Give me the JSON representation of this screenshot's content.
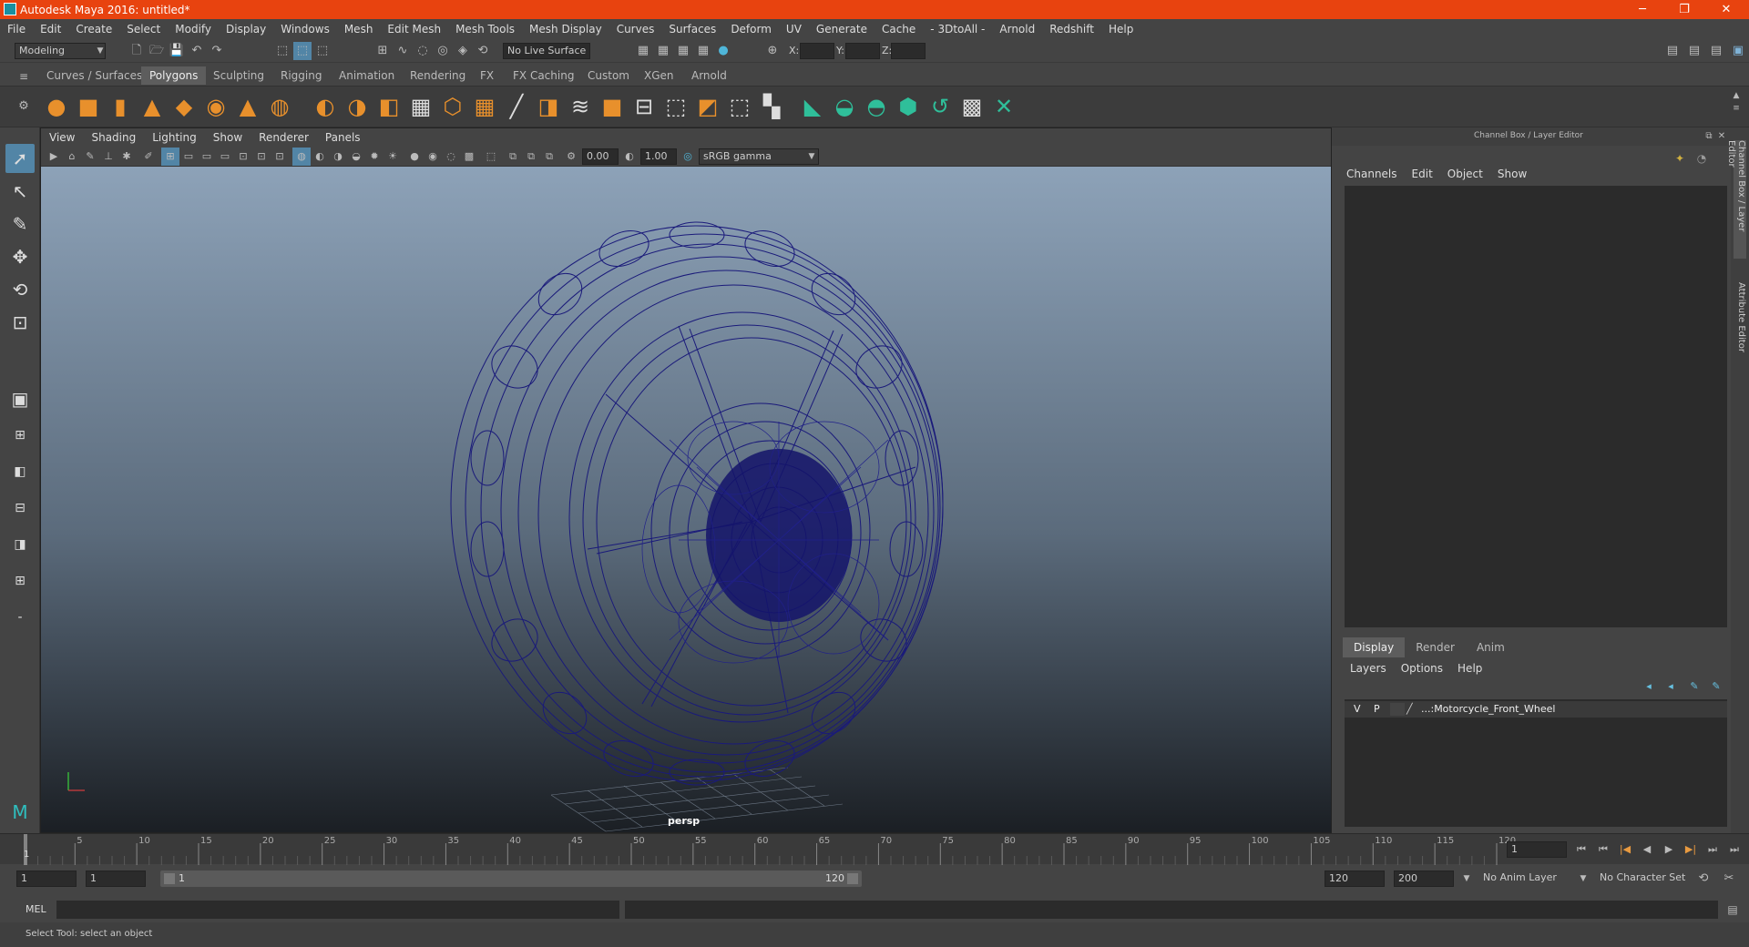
{
  "window": {
    "title": "Autodesk Maya 2016: untitled*",
    "min": "─",
    "restore": "❐",
    "close": "✕"
  },
  "menubar": [
    "File",
    "Edit",
    "Create",
    "Select",
    "Modify",
    "Display",
    "Windows",
    "Mesh",
    "Edit Mesh",
    "Mesh Tools",
    "Mesh Display",
    "Curves",
    "Surfaces",
    "Deform",
    "UV",
    "Generate",
    "Cache",
    "- 3DtoAll -",
    "Arnold",
    "Redshift",
    "Help"
  ],
  "statusline": {
    "mode": "Modeling",
    "live_surface": "No Live Surface",
    "x_label": "X:",
    "y_label": "Y:",
    "z_label": "Z:"
  },
  "shelf_tabs": [
    "Curves / Surfaces",
    "Polygons",
    "Sculpting",
    "Rigging",
    "Animation",
    "Rendering",
    "FX",
    "FX Caching",
    "Custom",
    "XGen",
    "Arnold"
  ],
  "shelf_active": "Polygons",
  "viewport": {
    "menu": [
      "View",
      "Shading",
      "Lighting",
      "Show",
      "Renderer",
      "Panels"
    ],
    "exposure": "0.00",
    "gamma": "1.00",
    "color_space": "sRGB gamma",
    "camera": "persp"
  },
  "channel_box": {
    "title": "Channel Box / Layer Editor",
    "menu": [
      "Channels",
      "Edit",
      "Object",
      "Show"
    ],
    "layer_tabs": [
      "Display",
      "Render",
      "Anim"
    ],
    "layer_menu": [
      "Layers",
      "Options",
      "Help"
    ],
    "layer": {
      "v": "V",
      "p": "P",
      "name": "...:Motorcycle_Front_Wheel"
    }
  },
  "right_tabs": [
    "Channel Box / Layer Editor",
    "Attribute Editor"
  ],
  "timeline": {
    "ticks": [
      "5",
      "10",
      "15",
      "20",
      "25",
      "30",
      "35",
      "40",
      "45",
      "50",
      "55",
      "60",
      "65",
      "70",
      "75",
      "80",
      "85",
      "90",
      "95",
      "100",
      "105",
      "110",
      "115",
      "120"
    ],
    "current_marker": "1",
    "current_frame": "1"
  },
  "range": {
    "start": "1",
    "anim_start": "1",
    "slider_start": "1",
    "slider_end": "120",
    "anim_end": "120",
    "end": "200",
    "anim_layer": "No Anim Layer",
    "character_set": "No Character Set"
  },
  "cmdline": {
    "label": "MEL"
  },
  "helpline": {
    "text": "Select Tool: select an object"
  }
}
